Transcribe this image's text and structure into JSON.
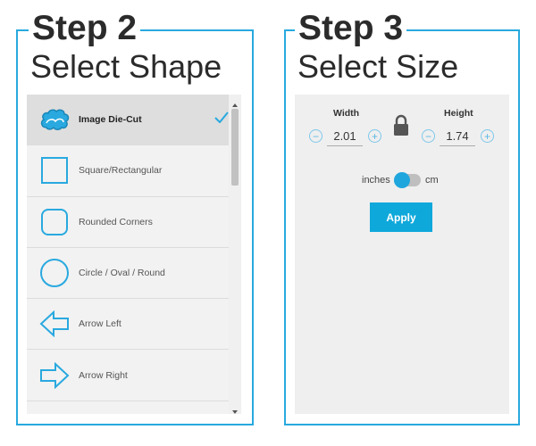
{
  "step2": {
    "heading": "Step 2",
    "subheading": "Select Shape"
  },
  "step3": {
    "heading": "Step 3",
    "subheading": "Select Size"
  },
  "shapes": [
    {
      "label": "Image Die-Cut",
      "icon": "cloud-shape-icon",
      "selected": true
    },
    {
      "label": "Square/Rectangular",
      "icon": "square-shape-icon",
      "selected": false
    },
    {
      "label": "Rounded Corners",
      "icon": "rounded-square-shape-icon",
      "selected": false
    },
    {
      "label": "Circle / Oval / Round",
      "icon": "circle-shape-icon",
      "selected": false
    },
    {
      "label": "Arrow Left",
      "icon": "arrow-left-shape-icon",
      "selected": false
    },
    {
      "label": "Arrow Right",
      "icon": "arrow-right-shape-icon",
      "selected": false
    }
  ],
  "size": {
    "width_label": "Width",
    "height_label": "Height",
    "width_value": "2.01",
    "height_value": "1.74",
    "minus_symbol": "−",
    "plus_symbol": "+",
    "unit_left": "inches",
    "unit_right": "cm",
    "unit_selected": "inches",
    "apply_label": "Apply"
  },
  "colors": {
    "accent": "#29a9df",
    "button": "#0fa8db",
    "selected_row": "#dedede",
    "list_bg": "#f2f2f2"
  }
}
